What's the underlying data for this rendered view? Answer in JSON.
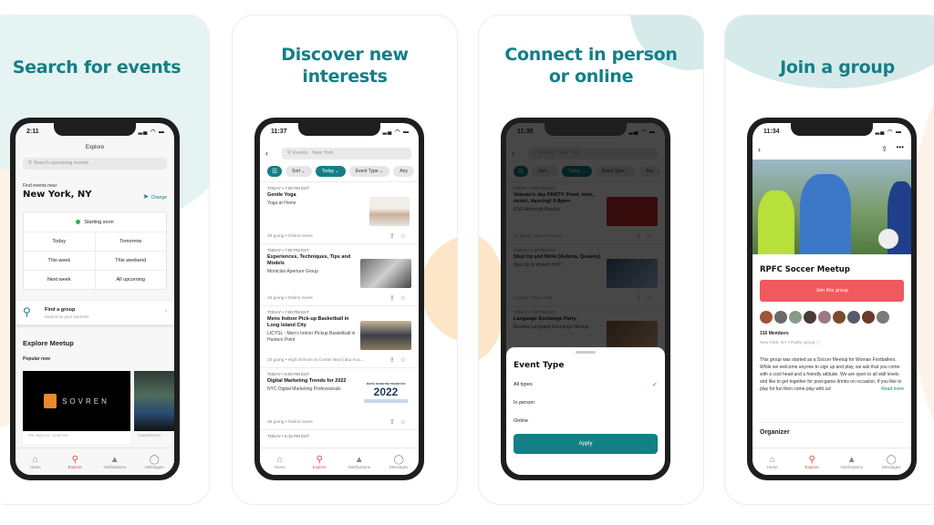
{
  "panels": [
    {
      "headline": "Search for events",
      "phone": {
        "time": "2:11",
        "screen_title": "Explore",
        "search_placeholder": "Search upcoming events",
        "find_near_label": "Find events near",
        "location": "New York, NY",
        "change_label": "Change",
        "starting_soon": "Starting soon",
        "date_filters": [
          [
            "Today",
            "Tomorrow"
          ],
          [
            "This week",
            "This weekend"
          ],
          [
            "Next week",
            "All upcoming"
          ]
        ],
        "find_group_title": "Find a group",
        "find_group_subtitle": "Search by your interests",
        "section_title": "Explore Meetup",
        "popular_label": "Popular now",
        "popular_cards": [
          {
            "brand": "SOVREN",
            "caption": "FRI, NOV 12 · 10:00 PM"
          },
          {
            "brand": "",
            "caption": "TOMORROW ·"
          }
        ]
      }
    },
    {
      "headline": "Discover new interests",
      "phone": {
        "time": "11:37",
        "search_placeholder": "Events · New York",
        "chips": [
          "Sort",
          "Today",
          "Event Type",
          "Any"
        ],
        "events": [
          {
            "time": "TODAY • 7:00 PM EST",
            "title": "Gentle Yoga",
            "group": "Yoga at Home",
            "meta": "49 going • Online event"
          },
          {
            "time": "TODAY • 7:00 PM EST",
            "title": "Experiences, Techniques, Tips and Models",
            "group": "Montclair Aperture Group",
            "meta": "16 going • Online event"
          },
          {
            "time": "TODAY • 7:00 PM EST",
            "title": "Mens Indoor Pick-up Basketball in Long Island City",
            "group": "LICYSL - Men's Indoor Pickup Basketball in Hunters Point",
            "meta": "22 going • High School on Center Blvd (aka Aca..."
          },
          {
            "time": "TODAY • 5:00 PM EST",
            "title": "Digital Marketing Trends for 2022",
            "group": "NYC Digital Marketing Professionals",
            "meta": "36 going • Online event",
            "thumb_text": "2022",
            "thumb_caption": "DIGITAL MARKETING TRENDS FOR"
          },
          {
            "time": "TODAY • 6:15 PM EST"
          }
        ]
      }
    },
    {
      "headline": "Connect in person or online",
      "phone": {
        "time": "11:35",
        "search_placeholder": "Events · New York",
        "chips": [
          "Sort",
          "Today",
          "Event Type",
          "Any"
        ],
        "events": [
          {
            "time": "TODAY • 6:00 PM EST",
            "title": "Veteran's day PARTY: Food, wine, music, dancing! 6-8pm+",
            "group": "KSG Afterwork Meetup",
            "meta": "41 going • Sports Fusion"
          },
          {
            "time": "TODAY • 6:30 PM EST",
            "title": "Shut Up and Write [Astoria, Queens]",
            "group": "Shut Up & Write!® NYC",
            "meta": "3 going • Trine Cafe"
          },
          {
            "time": "TODAY • 7:00 PM EST",
            "title": "Language Exchange Party",
            "group": "Rosetta Language Exchange Meetup"
          }
        ],
        "sheet": {
          "title": "Event Type",
          "options": [
            {
              "label": "All types",
              "selected": true
            },
            {
              "label": "In person",
              "selected": false
            },
            {
              "label": "Online",
              "selected": false
            }
          ],
          "apply_label": "Apply"
        }
      }
    },
    {
      "headline": "Join a group",
      "phone": {
        "time": "11:34",
        "group_name": "RPFC Soccer Meetup",
        "join_label": "Join this group",
        "members": "316 Members",
        "location_meta": "New York, NY • Public group",
        "description": "This group was started as a Soccer Meetup for Woman Footballers. While we welcome anyone to sign up and play, we ask that you come with a cool head and a friendly attitude. We are open to all skill levels and like to get together for post-game drinks on occasion. If you like to play for fun then come play with us!",
        "read_more": "Read more",
        "organizer_label": "Organizer"
      }
    }
  ],
  "tabbar": [
    {
      "label": "Home",
      "icon": "home-icon",
      "glyph": "⌂"
    },
    {
      "label": "Explore",
      "icon": "search-icon",
      "glyph": "⚲",
      "active": true
    },
    {
      "label": "Notifications",
      "icon": "bell-icon",
      "glyph": "🔔"
    },
    {
      "label": "Messages",
      "icon": "chat-icon",
      "glyph": "◯"
    }
  ],
  "colors": {
    "brand_teal": "#137f87",
    "join_red": "#ef5a5e",
    "active_tab": "#e04a4a"
  }
}
